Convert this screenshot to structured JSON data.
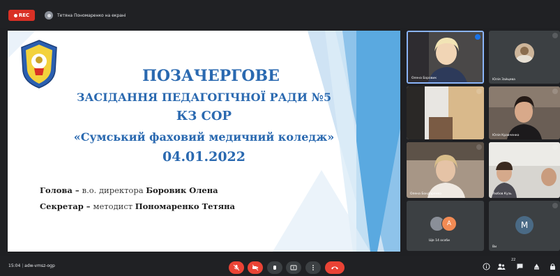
{
  "topbar": {
    "rec_label": "REC",
    "presenter_text": "Тетяна Пономаренко на екрані"
  },
  "slide": {
    "title1": "ПОЗАЧЕРГОВЕ",
    "title2": "ЗАСІДАННЯ ПЕДАГОГІЧНОЇ РАДИ №5",
    "title3": "КЗ СОР",
    "title4": "«Сумський фаховий медичний коледж»",
    "date": "04.01.2022",
    "chair_label": "Голова",
    "chair_sep": " – ",
    "chair_role": "в.о. директора ",
    "chair_name": "Боровик Олена",
    "secretary_label": "Секретар",
    "secretary_sep": " – ",
    "secretary_role": "методист ",
    "secretary_name": "Пономаренко Тетяна"
  },
  "participants": [
    {
      "name": "Олена Боровик"
    },
    {
      "name": "Юлія Зайцева"
    },
    {
      "name": ""
    },
    {
      "name": "Юлія Кравченко"
    },
    {
      "name": "Олена Бондаренко"
    },
    {
      "name": "Любов Кузь"
    },
    {
      "name": "Ще 14 особи"
    },
    {
      "name": "Ви",
      "initial": "M"
    }
  ],
  "bottombar": {
    "time": "15:04",
    "meeting": "adw-vmsz-ogp",
    "participants_count": "22"
  },
  "colors": {
    "accent_blue": "#2a69b0",
    "end_call_red": "#ea4335",
    "rec_red": "#d93025",
    "mic_off_orange": "#e8552f"
  }
}
